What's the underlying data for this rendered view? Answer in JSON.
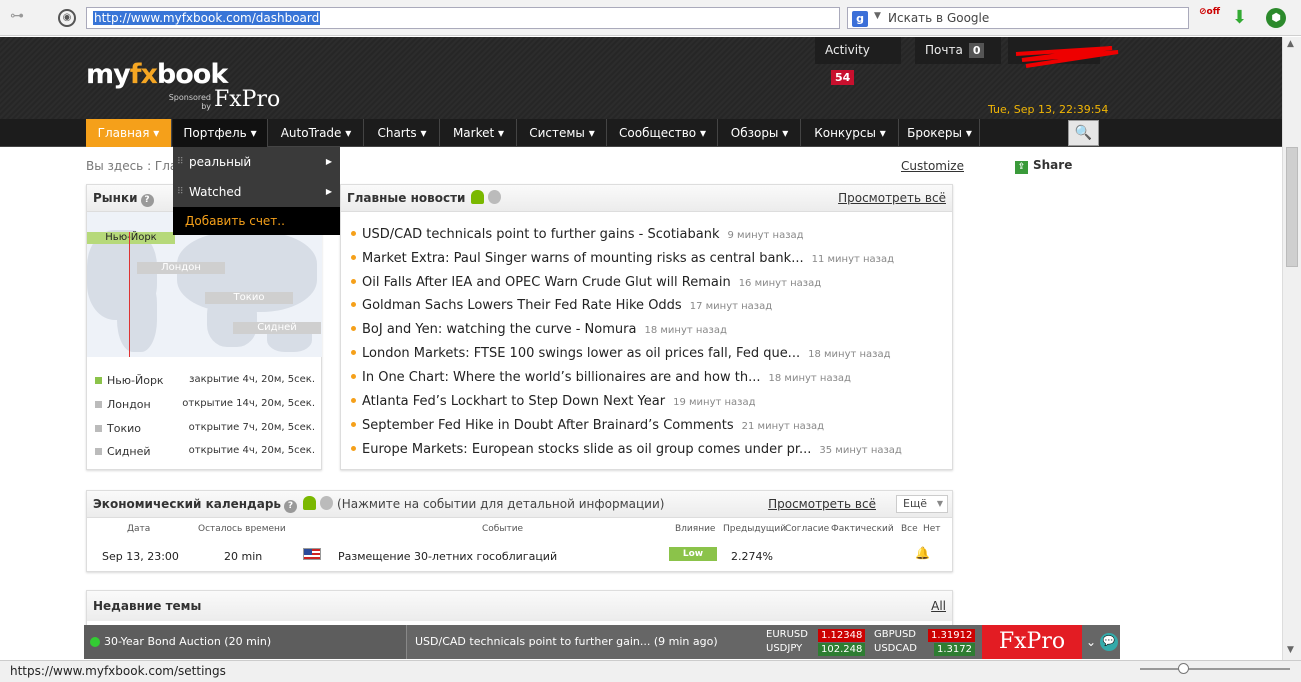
{
  "browser": {
    "url": "http://www.myfxbook.com/dashboard",
    "search_placeholder": "Искать в Google",
    "status_url": "https://www.myfxbook.com/settings"
  },
  "header": {
    "logo_pre": "my",
    "logo_fx": "fx",
    "logo_post": "book",
    "sponsored": "Sponsored by",
    "sponsor": "FxPro",
    "activity_label": "Activity",
    "activity_count": "54",
    "mail_label": "Почта",
    "mail_count": "0",
    "datetime": "Tue, Sep 13, 22:39:54"
  },
  "nav": {
    "items": [
      {
        "label": "Главная ▾"
      },
      {
        "label": "Портфель ▾"
      },
      {
        "label": "AutoTrade ▾"
      },
      {
        "label": "Charts ▾"
      },
      {
        "label": "Market ▾"
      },
      {
        "label": "Системы ▾"
      },
      {
        "label": "Сообщество ▾"
      },
      {
        "label": "Обзоры ▾"
      },
      {
        "label": "Конкурсы ▾"
      },
      {
        "label": "Брокеры ▾"
      }
    ]
  },
  "portfolio_menu": {
    "items": [
      "реальный",
      "Watched"
    ],
    "add": "Добавить счет.."
  },
  "page": {
    "breadcrumb": "Вы здесь : Глав",
    "customize": "Customize",
    "share": "Share"
  },
  "markets": {
    "title": "Рынки",
    "cities_map": [
      "Нью-Йорк",
      "Лондон",
      "Токио",
      "Сидней"
    ],
    "rows": [
      {
        "city": "Нью-Йорк",
        "status": "закрытие 4ч, 20м, 5сек."
      },
      {
        "city": "Лондон",
        "status": "открытие 14ч, 20м, 5сек."
      },
      {
        "city": "Токио",
        "status": "открытие 7ч, 20м, 5сек."
      },
      {
        "city": "Сидней",
        "status": "открытие 4ч, 20м, 5сек."
      }
    ]
  },
  "news": {
    "title": "Главные новости",
    "view_all": "Просмотреть всё",
    "items": [
      {
        "text": "USD/CAD technicals point to further gains - Scotiabank",
        "ago": "9 минут назад"
      },
      {
        "text": "Market Extra: Paul Singer warns of mounting risks as central bank...",
        "ago": "11 минут назад"
      },
      {
        "text": "Oil Falls After IEA and OPEC Warn Crude Glut will Remain",
        "ago": "16 минут назад"
      },
      {
        "text": "Goldman Sachs Lowers Their Fed Rate Hike Odds",
        "ago": "17 минут назад"
      },
      {
        "text": "BoJ and Yen: watching the curve - Nomura",
        "ago": "18 минут назад"
      },
      {
        "text": "London Markets: FTSE 100 swings lower as oil prices fall, Fed que...",
        "ago": "18 минут назад"
      },
      {
        "text": "In One Chart: Where the world’s billionaires are and how th...",
        "ago": "18 минут назад"
      },
      {
        "text": "Atlanta Fed’s Lockhart to Step Down Next Year",
        "ago": "19 минут назад"
      },
      {
        "text": "September Fed Hike in Doubt After Brainard’s Comments",
        "ago": "21 минут назад"
      },
      {
        "text": "Europe Markets: European stocks slide as oil group comes under pr...",
        "ago": "35 минут назад"
      }
    ]
  },
  "calendar": {
    "title": "Экономический календарь",
    "hint": "(Нажмите на событии для детальной информации)",
    "view_all": "Просмотреть всё",
    "more": "Ещё",
    "cols": [
      "Дата",
      "Осталось времени",
      "Событие",
      "Влияние",
      "Предыдущий",
      "Согласие",
      "Фактический",
      "Все",
      "Нет"
    ],
    "row": {
      "date": "Sep 13, 23:00",
      "remaining": "20 min",
      "event": "Размещение 30-летних гособлигаций",
      "impact": "Low",
      "previous": "2.274%"
    }
  },
  "topics": {
    "title": "Недавние темы",
    "all": "All"
  },
  "ticker": {
    "event": "30-Year Bond Auction (20 min)",
    "news": "USD/CAD technicals point to further gain...  (9 min ago)",
    "pairs": [
      {
        "name": "EURUSD",
        "value": "1.12348",
        "dir": "red"
      },
      {
        "name": "USDJPY",
        "value": "102.248",
        "dir": "grn"
      },
      {
        "name": "GBPUSD",
        "value": "1.31912",
        "dir": "red"
      },
      {
        "name": "USDCAD",
        "value": "1.3172",
        "dir": "grn"
      }
    ],
    "brand": "FxPro"
  }
}
